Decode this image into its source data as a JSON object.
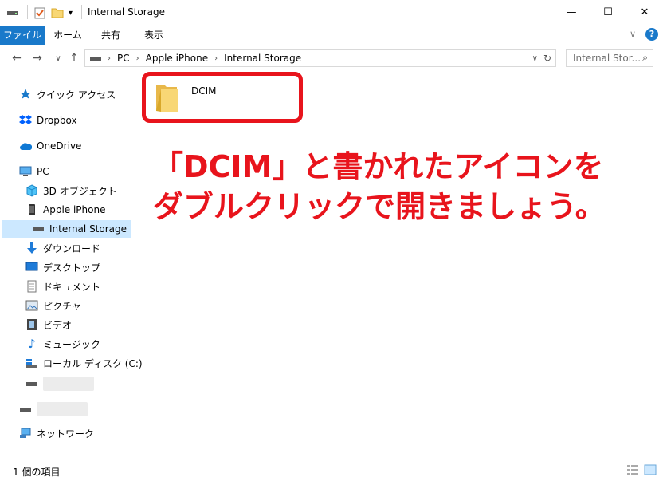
{
  "window": {
    "title": "Internal Storage"
  },
  "ribbon": {
    "tabs": [
      "ファイル",
      "ホーム",
      "共有",
      "表示"
    ]
  },
  "address": {
    "crumbs": [
      "PC",
      "Apple iPhone",
      "Internal Storage"
    ]
  },
  "search": {
    "placeholder": "Internal Stor..."
  },
  "sidebar": {
    "quick_access": "クイック アクセス",
    "dropbox": "Dropbox",
    "onedrive": "OneDrive",
    "pc": "PC",
    "objects3d": "3D オブジェクト",
    "iphone": "Apple iPhone",
    "internal_storage": "Internal Storage",
    "downloads": "ダウンロード",
    "desktop": "デスクトップ",
    "documents": "ドキュメント",
    "pictures": "ピクチャ",
    "videos": "ビデオ",
    "music": "ミュージック",
    "local_disk": "ローカル ディスク (C:)",
    "network": "ネットワーク"
  },
  "content": {
    "folder_name": "DCIM"
  },
  "annotation": {
    "line1": "「DCIM」と書かれたアイコンを",
    "line2": "ダブルクリックで開きましょう。",
    "color": "#e8141c"
  },
  "status": {
    "item_count": "1 個の項目"
  },
  "colors": {
    "accent": "#1979ca",
    "selected": "#cce8ff"
  }
}
